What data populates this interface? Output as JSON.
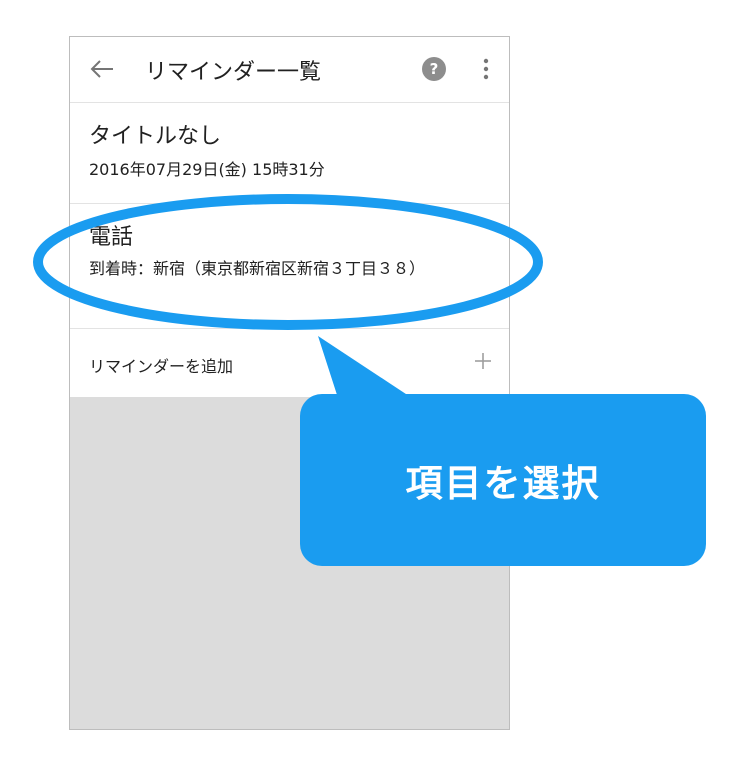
{
  "appbar": {
    "back_icon": "arrow-left-icon",
    "title": "リマインダー一覧",
    "help_icon": "question-mark-circle-icon",
    "help_glyph": "?",
    "more_icon": "vertical-dots-icon"
  },
  "reminders": [
    {
      "title": "タイトルなし",
      "detail": "2016年07月29日(金) 15時31分"
    },
    {
      "title": "電話",
      "detail": "到着時：新宿（東京都新宿区新宿３丁目３８）"
    }
  ],
  "add_reminder": {
    "label": "リマインダーを追加",
    "icon": "plus-icon"
  },
  "annotation": {
    "callout_text": "項目を選択",
    "callout_color": "#1a9cf0",
    "highlight_ring_color": "#1a9cf0"
  }
}
